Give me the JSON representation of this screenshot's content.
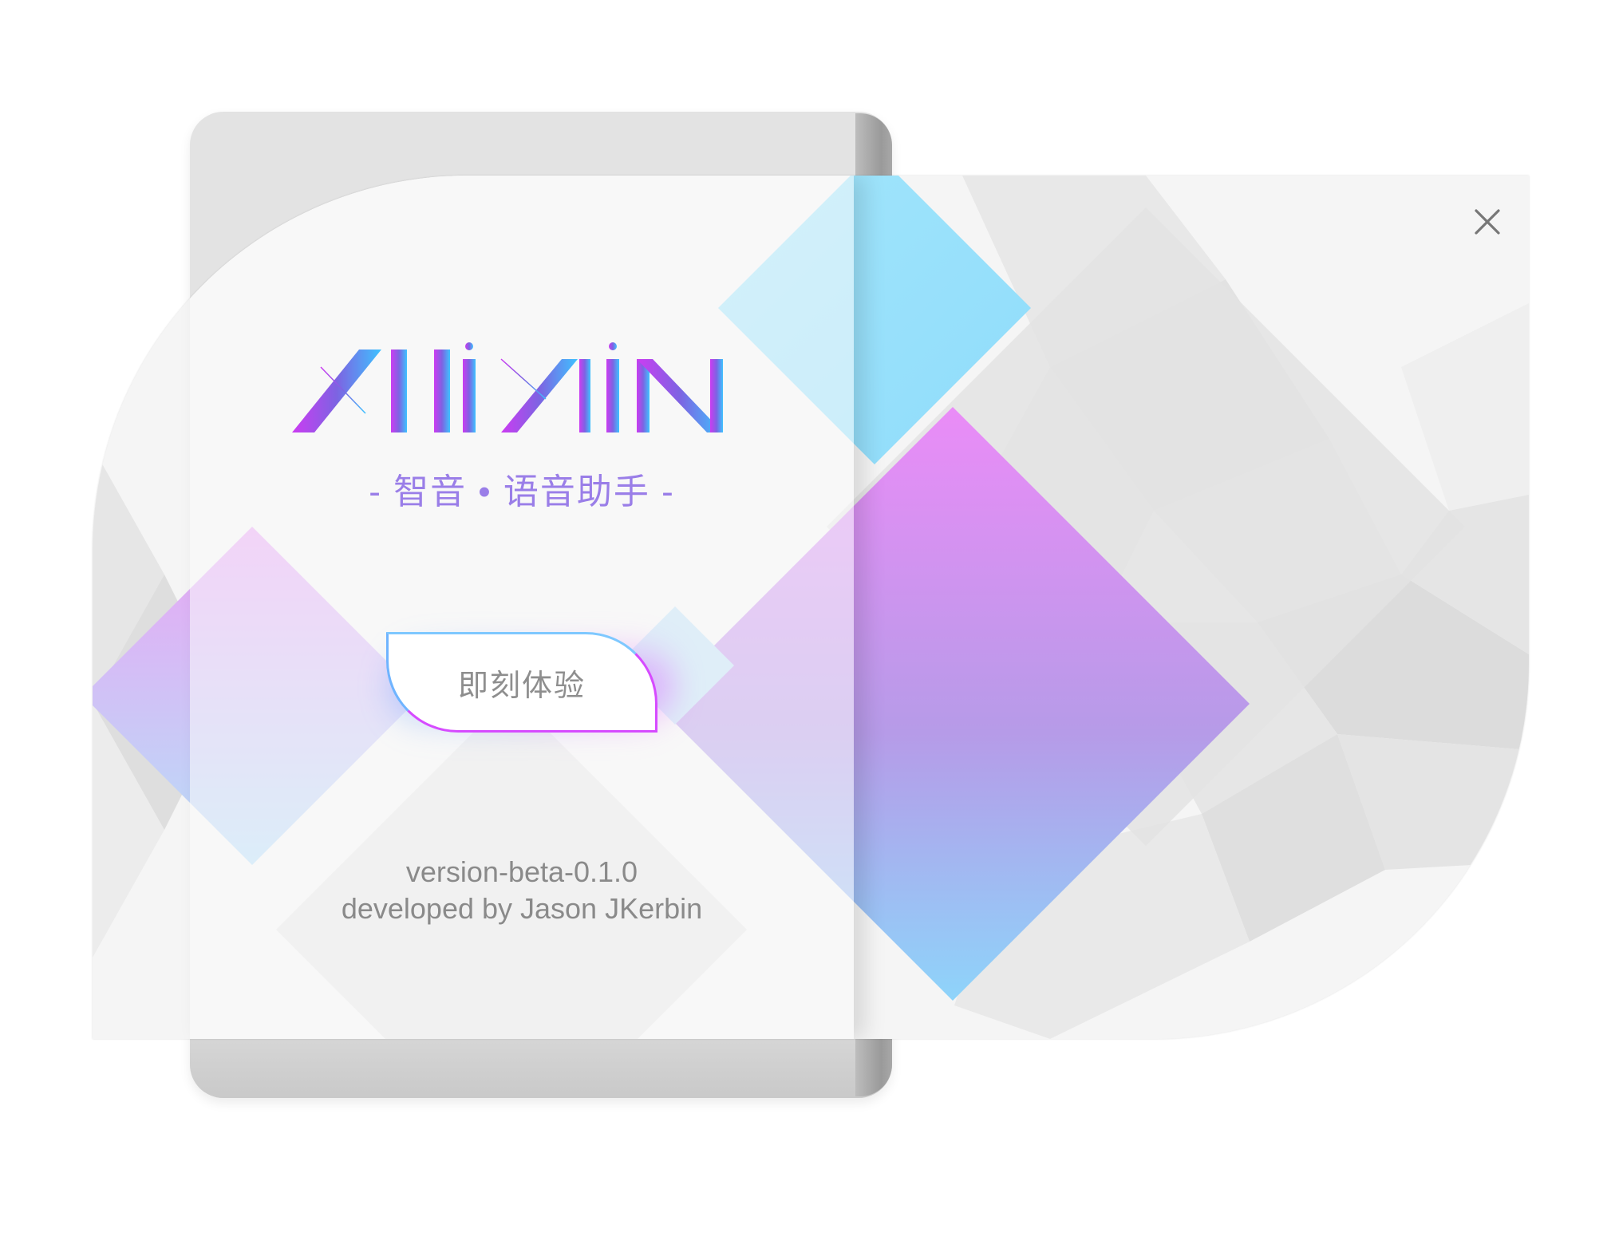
{
  "app": {
    "logo_text": "ZHIYIN",
    "subtitle": "- 智音 • 语音助手 -",
    "cta_label": "即刻体验",
    "version": "version-beta-0.1.0",
    "developer": "developed by Jason JKerbin"
  },
  "window": {
    "close_icon": "close-icon"
  },
  "colors": {
    "accent_purple": "#c73cf0",
    "accent_blue": "#4cc4ff",
    "subtitle": "#9a7ee8",
    "text_muted": "#8a8a8a"
  }
}
